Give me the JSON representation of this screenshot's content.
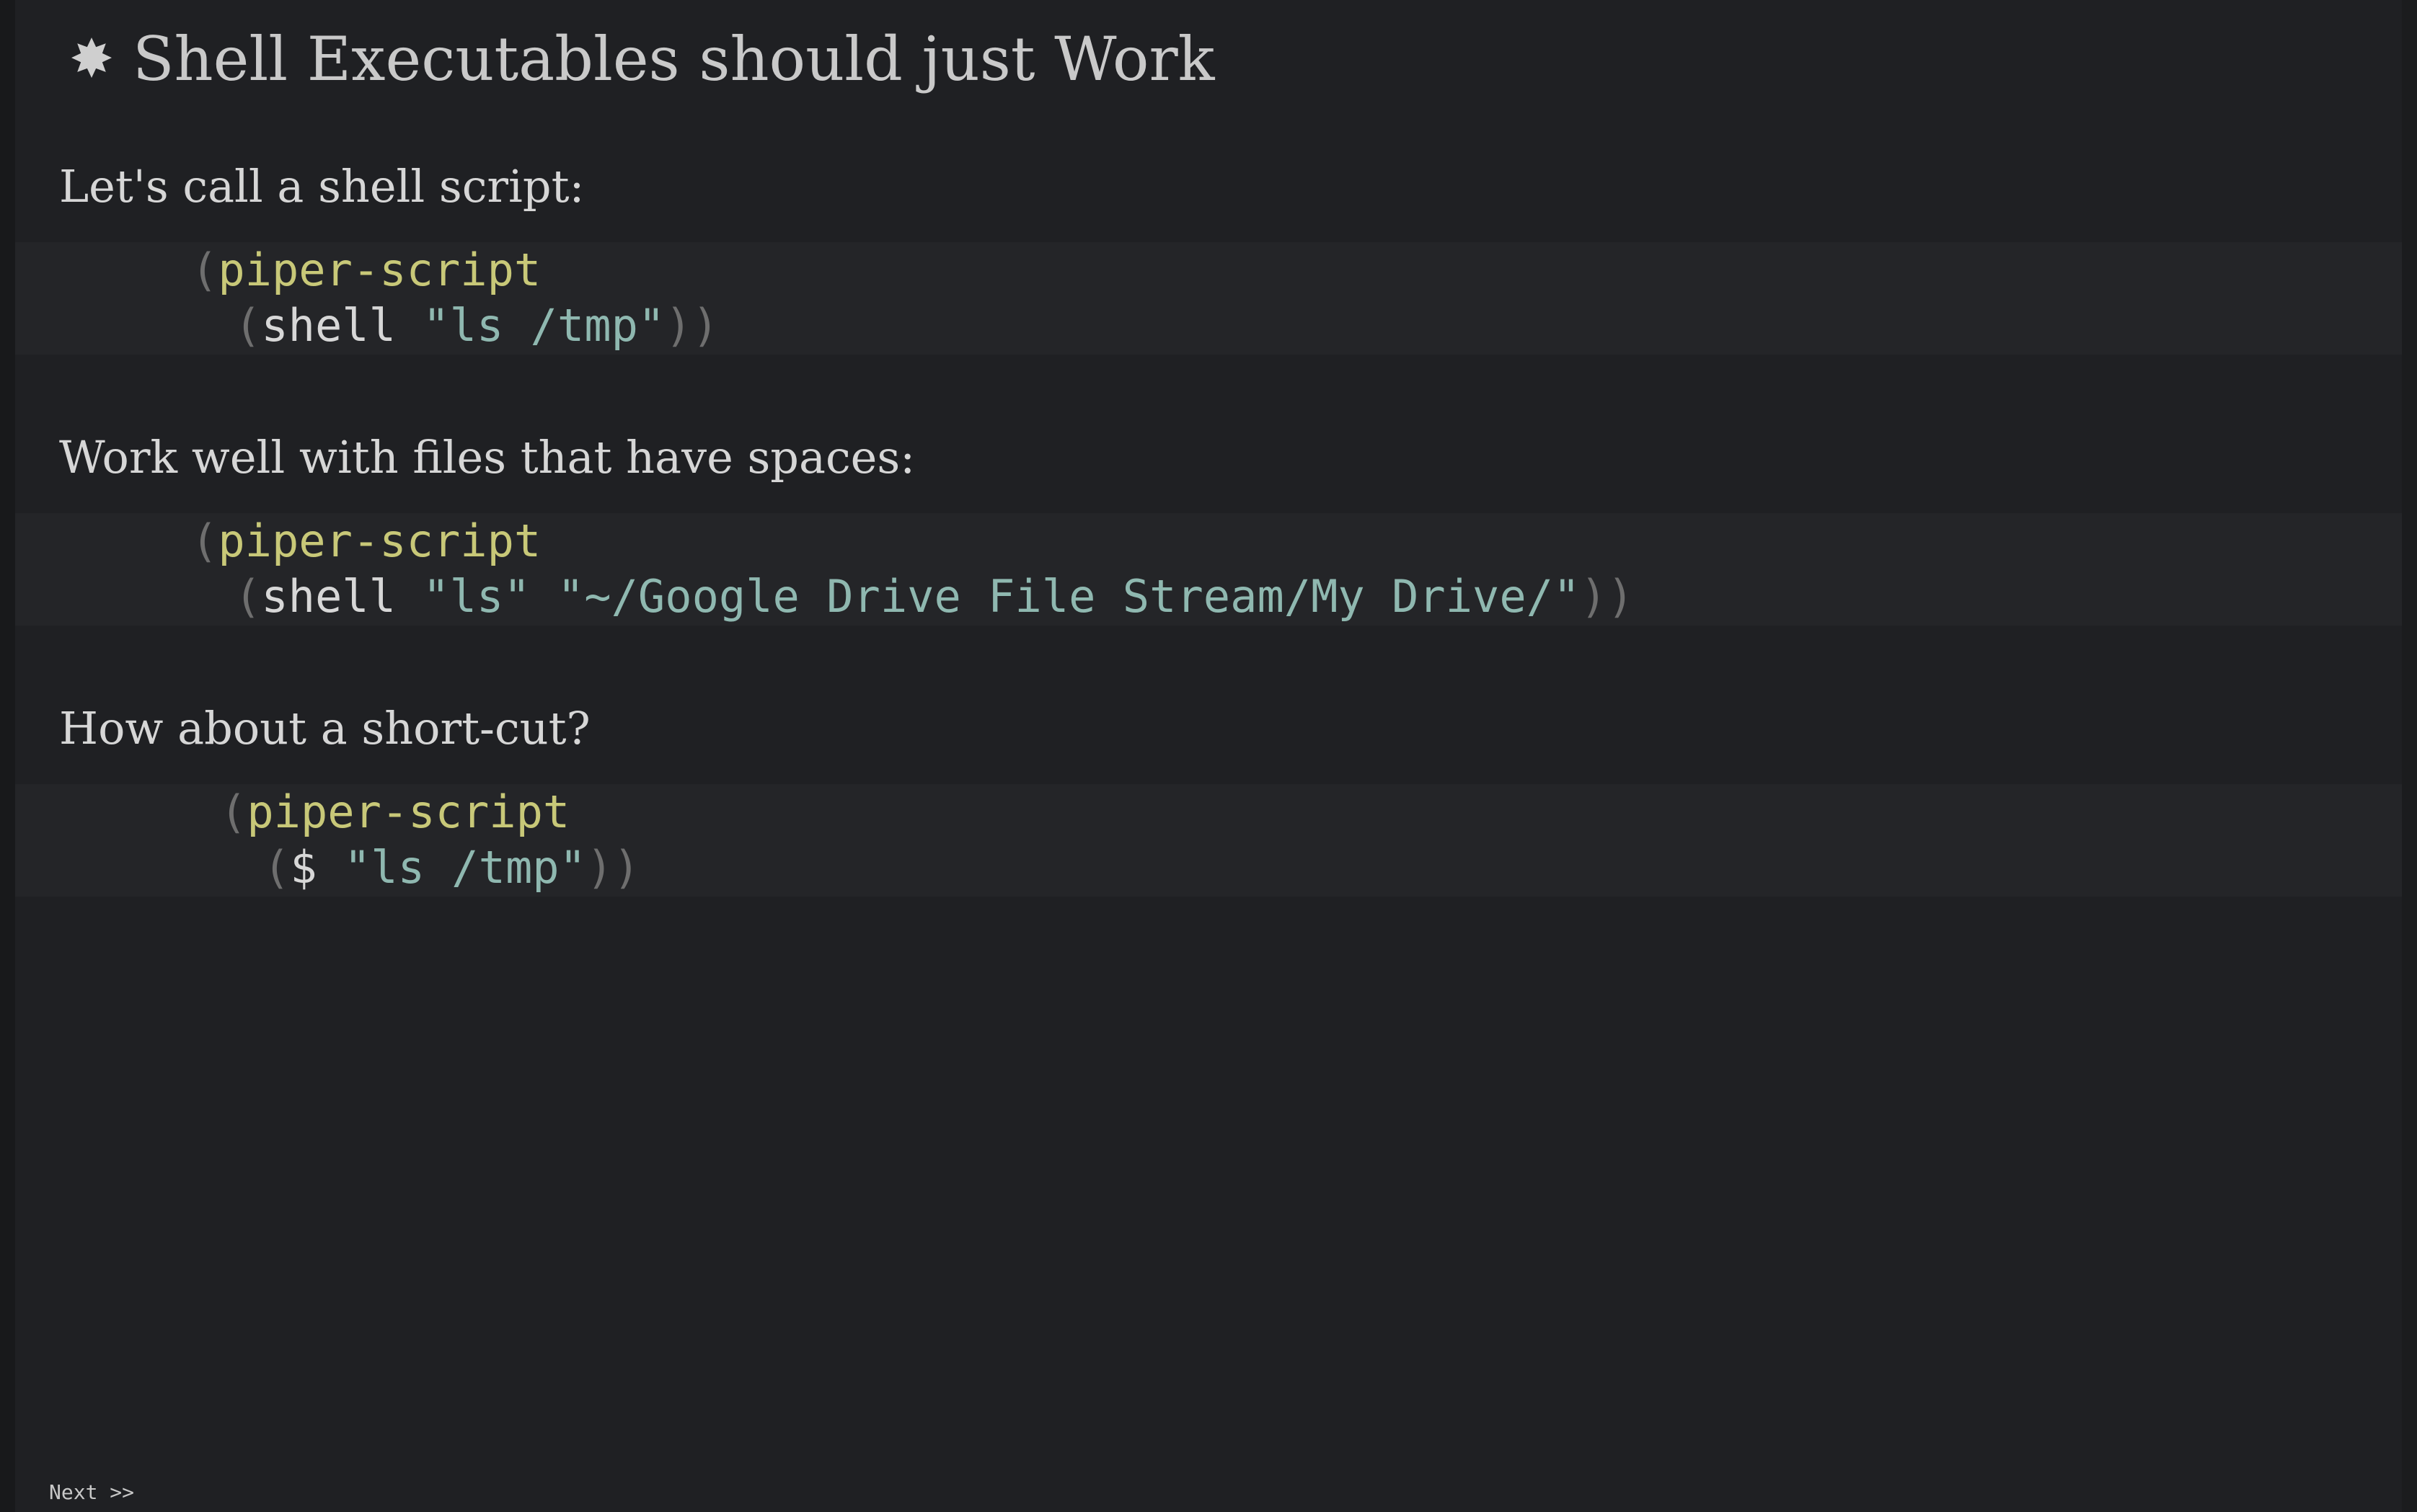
{
  "heading": {
    "bullet": "✸",
    "title": "Shell Executables should just Work"
  },
  "sections": [
    {
      "text": "Let's call a shell script:",
      "code": {
        "line1": {
          "open": "(",
          "fn": "piper-script"
        },
        "line2": {
          "open": "(",
          "sym": "shell",
          "args": "\"ls /tmp\"",
          "close": "))"
        }
      }
    },
    {
      "text": "Work well with files that have spaces:",
      "code": {
        "line1": {
          "open": "(",
          "fn": "piper-script"
        },
        "line2": {
          "open": "(",
          "sym": "shell",
          "args": "\"ls\" \"~/Google Drive File Stream/My Drive/\"",
          "close": "))"
        }
      }
    },
    {
      "text": "How about a short-cut?",
      "code": {
        "line1": {
          "open": "(",
          "fn": "piper-script"
        },
        "line2": {
          "open": "(",
          "sym": "$",
          "args": "\"ls /tmp\"",
          "close": "))"
        }
      }
    }
  ],
  "footer": {
    "next_label": "Next >>"
  }
}
